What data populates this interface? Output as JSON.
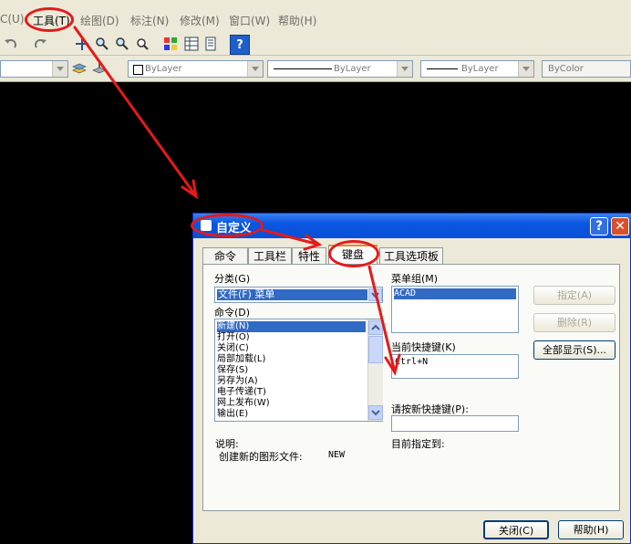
{
  "menubar": {
    "items": [
      "C(U)",
      "工具(T)",
      "绘图(D)",
      "标注(N)",
      "修改(M)",
      "窗口(W)",
      "帮助(H)"
    ]
  },
  "toolbar2": {
    "color_combo": "ByLayer",
    "linetype_combo": "ByLayer",
    "lineweight_combo": "ByLayer",
    "plotstyle_combo": "ByColor"
  },
  "dialog": {
    "title": "自定义",
    "tabs": [
      "命令",
      "工具栏",
      "特性",
      "键盘",
      "工具选项板"
    ],
    "category_label": "分类(G)",
    "category_value": "文件(F) 菜单",
    "commands_label": "命令(D)",
    "commands": [
      "新建(N)",
      "打开(O)",
      "关闭(C)",
      "局部加载(L)",
      "保存(S)",
      "另存为(A)",
      "电子传递(T)",
      "网上发布(W)",
      "输出(E)"
    ],
    "menu_group_label": "菜单组(M)",
    "menu_group_value": "ACAD",
    "assign_button": "指定(A)",
    "delete_button": "删除(R)",
    "show_all_button": "全部显示(S)...",
    "current_keys_label": "当前快捷键(K)",
    "current_keys_value": "Ctrl+N",
    "new_key_label": "请按新快捷键(P):",
    "new_key_value": "",
    "assigned_to_label": "目前指定到:",
    "description_label": "说明:",
    "description_text": "创建新的图形文件:",
    "description_code": "NEW",
    "close_button": "关闭(C)",
    "help_button": "帮助(H)"
  },
  "colors": {
    "titlebar": "#0a56e2",
    "selection": "#316ac5",
    "annotation": "#e41a1a",
    "chrome": "#ece9d8"
  }
}
